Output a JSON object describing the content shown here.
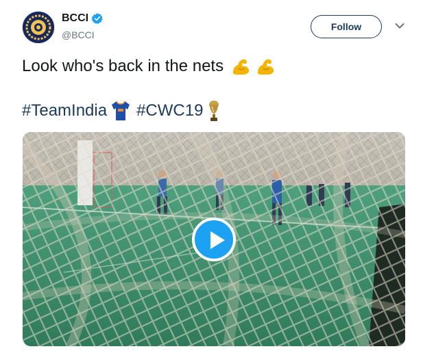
{
  "author": {
    "display_name": "BCCI",
    "handle": "@BCCI",
    "verified": true,
    "avatar_icon": "bcci-logo-icon"
  },
  "actions": {
    "follow_label": "Follow",
    "menu_icon": "chevron-down-icon"
  },
  "tweet": {
    "text": "Look who's back in the nets",
    "text_emoji": [
      "flexed-biceps-icon",
      "flexed-biceps-icon"
    ],
    "hashtags": [
      {
        "label": "#TeamIndia",
        "trailing_icon": "india-jersey-icon"
      },
      {
        "label": "#CWC19",
        "trailing_icon": "world-cup-trophy-icon"
      }
    ]
  },
  "media": {
    "type": "video",
    "scene": "cricket-nets-practice",
    "play_icon": "play-icon"
  },
  "colors": {
    "link": "#1b3a5c",
    "text": "#14171a",
    "secondary": "#657786",
    "verified": "#1da1f2",
    "play": "#1da1f2"
  }
}
